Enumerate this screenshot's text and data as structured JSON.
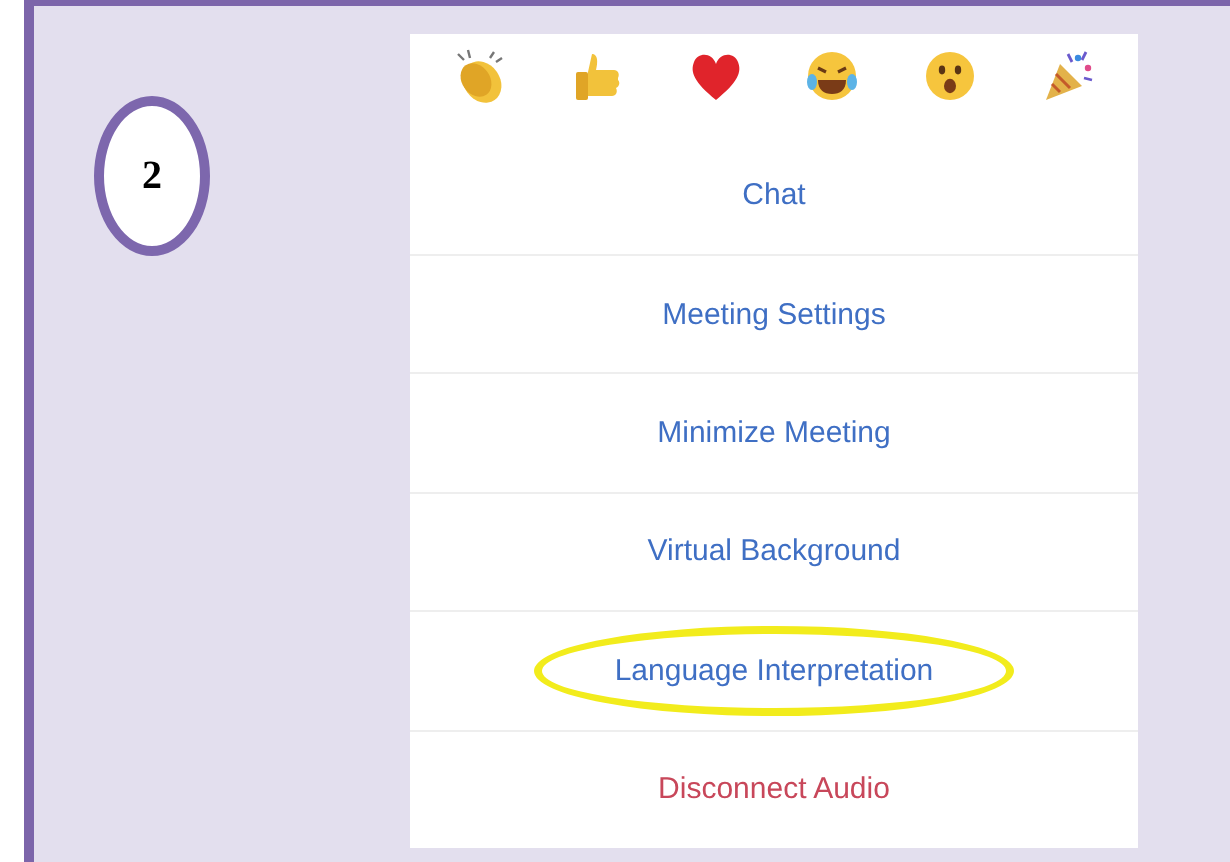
{
  "step": {
    "number": "2"
  },
  "menu": {
    "items": [
      {
        "label": "Chat",
        "kind": "normal",
        "circled": false
      },
      {
        "label": "Meeting Settings",
        "kind": "normal",
        "circled": false
      },
      {
        "label": "Minimize Meeting",
        "kind": "normal",
        "circled": false
      },
      {
        "label": "Virtual Background",
        "kind": "normal",
        "circled": false
      },
      {
        "label": "Language Interpretation",
        "kind": "normal",
        "circled": true
      },
      {
        "label": "Disconnect Audio",
        "kind": "danger",
        "circled": false
      }
    ]
  }
}
